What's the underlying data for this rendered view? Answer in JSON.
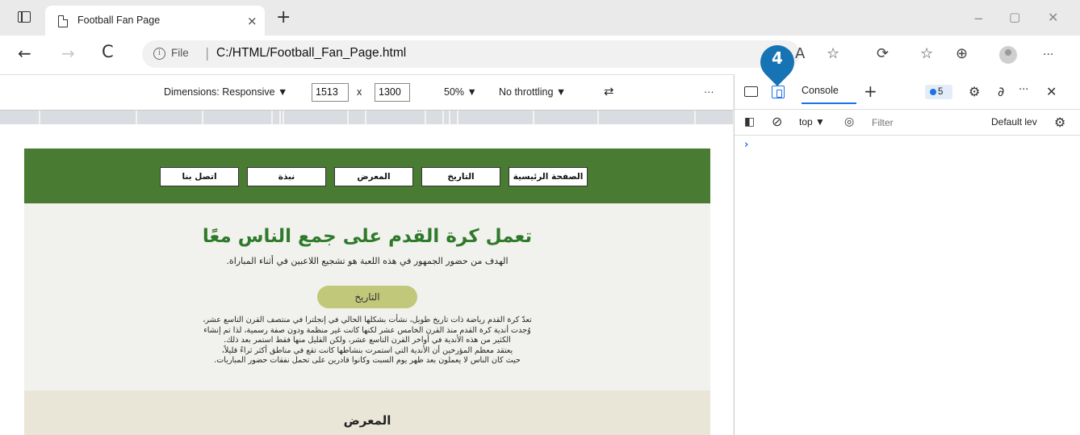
{
  "browser": {
    "tab_title": "Football Fan Page",
    "tab_close": "×",
    "new_tab": "+",
    "win_min": "−",
    "win_max": "▢",
    "win_close": "✕",
    "address": {
      "scheme_label": "File",
      "separator": "|",
      "url": "C:/HTML/Football_Fan_Page.html"
    },
    "nav": {
      "back": "←",
      "forward": "→",
      "refresh": "C"
    },
    "more_label": "···"
  },
  "device_toolbar": {
    "dimensions_label": "Dimensions: Responsive ▼",
    "width": "1513",
    "times": "x",
    "height": "1300",
    "zoom": "50% ▼",
    "throttling": "No throttling ▼",
    "more": "···"
  },
  "web_page": {
    "menu": [
      "الصفحة الرئيسية",
      "التاريخ",
      "المعرض",
      "نبذة",
      "اتصل بنا"
    ],
    "hero_title": "تعمل كرة القدم على جمع الناس معًا",
    "hero_subtitle": "الهدف من حضور الجمهور في هذه اللعبة هو تشجيع اللاعبين في أثناء المباراة.",
    "history_button": "التاريخ",
    "history_lines": [
      "تعدّ كرة القدم رياضة ذات تاريخ طويل، نشأت بشكلها الحالي في إنجلترا في منتصف القرن التاسع عشر،",
      "وُجدت أندية كرة القدم منذ القرن الخامس عشر لكنها كانت غير منظمة ودون صفة رسمية، لذا تم إنشاء",
      "الكثير من هذه الأندية في أواخر القرن التاسع عشر، ولكن القليل منها فقط استمر بعد ذلك.",
      "يعتقد معظم المؤرخين أن الأندية التي استمرت بنشاطها كانت تقع في مناطق أكثر ثراءً قليلاً،",
      "حيث كان الناس لا يعملون بعد ظهر يوم السبت وكانوا قادرين على تحمل نفقات حضور المباريات."
    ],
    "gallery_title": "المعرض",
    "header_color": "#4a7b33",
    "title_color": "#2f7a2a",
    "button_color": "#c1c87a"
  },
  "devtools": {
    "console_tab": "Console",
    "add_tab": "+",
    "issues_count": "5",
    "context": "top ▼",
    "filter_placeholder": "Filter",
    "levels": "Default lev",
    "prompt": "›",
    "more": "···",
    "close": "✕"
  },
  "callout": {
    "step": "4",
    "color": "#1673b4"
  }
}
